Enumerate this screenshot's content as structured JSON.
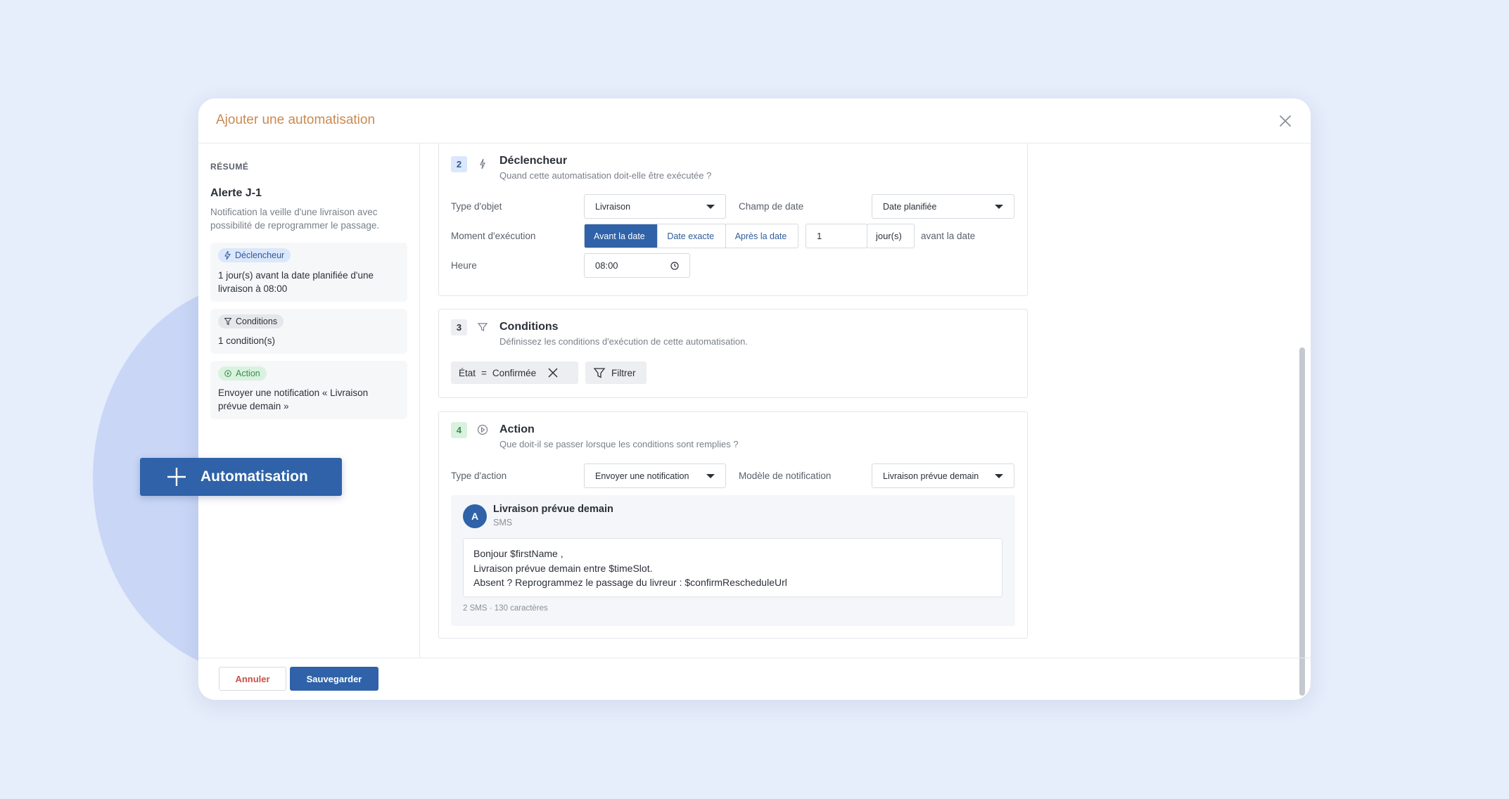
{
  "modal": {
    "title": "Ajouter une automatisation"
  },
  "summary": {
    "label": "RÉSUMÉ",
    "title": "Alerte J-1",
    "description": "Notification la veille d'une livraison avec possibilité de reprogrammer le passage.",
    "cards": [
      {
        "tag": "Déclencheur",
        "text": "1 jour(s) avant la date planifiée d'une livraison à 08:00"
      },
      {
        "tag": "Conditions",
        "text": "1 condition(s)"
      },
      {
        "tag": "Action",
        "text": "Envoyer une notification « Livraison prévue demain »"
      }
    ]
  },
  "trigger": {
    "number": "2",
    "title": "Déclencheur",
    "subtitle": "Quand cette automatisation doit-elle être exécutée ?",
    "object_type_label": "Type d'objet",
    "object_type_value": "Livraison",
    "date_field_label": "Champ de date",
    "date_field_value": "Date planifiée",
    "moment_label": "Moment d'exécution",
    "moment_options": [
      "Avant la date",
      "Date exacte",
      "Après la date"
    ],
    "moment_selected": "Avant la date",
    "offset_value": "1",
    "offset_unit": "jour(s)",
    "offset_suffix": "avant la date",
    "time_label": "Heure",
    "time_value": "08:00"
  },
  "conditions": {
    "number": "3",
    "title": "Conditions",
    "subtitle": "Définissez les conditions d'exécution de cette automatisation.",
    "chip_field": "État",
    "chip_operator": "=",
    "chip_value": "Confirmée",
    "filter_label": "Filtrer"
  },
  "action": {
    "number": "4",
    "title": "Action",
    "subtitle": "Que doit-il se passer lorsque les conditions sont remplies ?",
    "action_type_label": "Type d'action",
    "action_type_value": "Envoyer une notification",
    "template_label": "Modèle de notification",
    "template_value": "Livraison prévue demain",
    "preview": {
      "avatar": "A",
      "title": "Livraison prévue demain",
      "channel": "SMS",
      "lines": [
        "Bonjour $firstName ,",
        "Livraison prévue demain entre $timeSlot.",
        "Absent ? Reprogrammez le passage du livreur : $confirmRescheduleUrl"
      ],
      "counter": "2 SMS · 130 caractères"
    }
  },
  "footer": {
    "cancel_label": "Annuler",
    "save_label": "Sauvegarder"
  },
  "floating_button": {
    "label": "Automatisation"
  },
  "colors": {
    "primary": "#2f62a8",
    "title_accent": "#c98a52",
    "background": "#e6edfb"
  }
}
